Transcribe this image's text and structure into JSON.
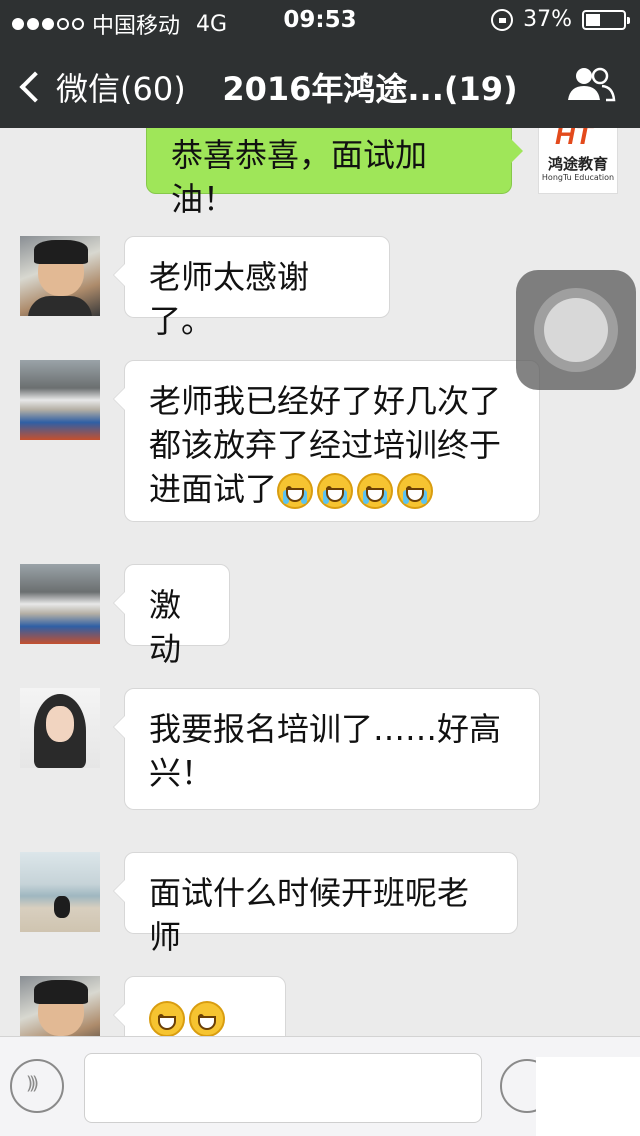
{
  "status": {
    "carrier": "中国移动",
    "network": "4G",
    "time": "09:53",
    "battery": "37%"
  },
  "nav": {
    "back_label": "微信(60)",
    "title": "2016年鸿途...(19)"
  },
  "logo": {
    "mark": "HT",
    "name": "鸿途教育",
    "sub": "HongTu Education"
  },
  "messages": [
    {
      "side": "out",
      "text": "恭喜恭喜，面试加油！"
    },
    {
      "side": "in",
      "text": "老师太感谢了。"
    },
    {
      "side": "in",
      "text": "老师我已经好了好几次了都该放弃了经过培训终于进面试了",
      "emojis": 4,
      "emoji": "crying-face"
    },
    {
      "side": "in",
      "text": "激动"
    },
    {
      "side": "in",
      "text": "我要报名培训了……好高兴！"
    },
    {
      "side": "in",
      "text": "面试什么时候开班呢老师"
    },
    {
      "side": "in",
      "text": "",
      "emojis": 3,
      "emoji": "grinning-face"
    }
  ],
  "colors": {
    "nav_bg": "#2e3132",
    "chat_bg": "#ebebeb",
    "outgoing_bubble": "#9fe659",
    "incoming_bubble": "#ffffff"
  }
}
